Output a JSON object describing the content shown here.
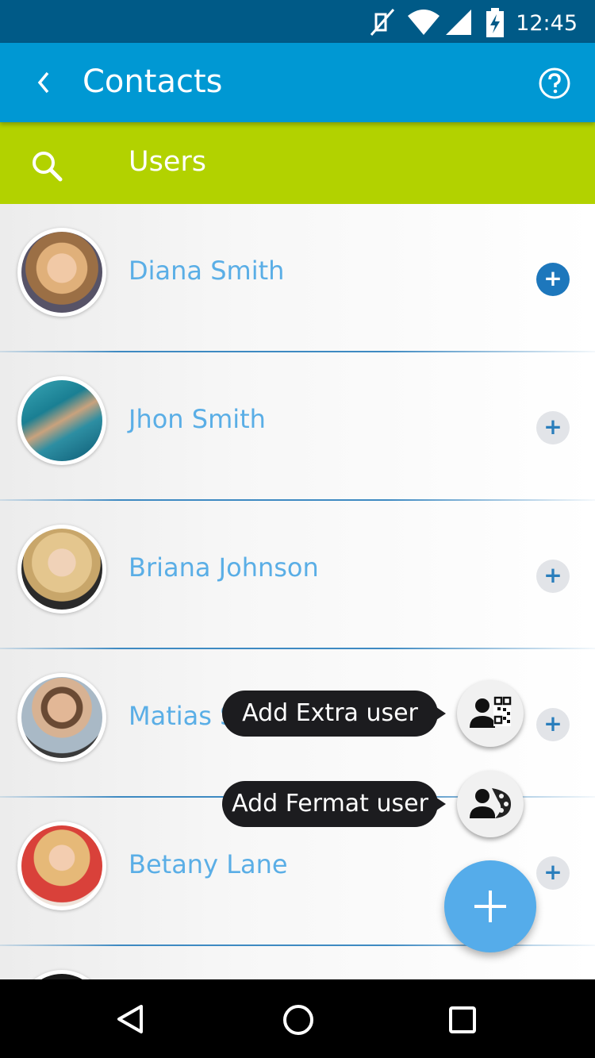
{
  "status_bar": {
    "time": "12:45",
    "icons": [
      "muted-icon",
      "wifi-icon",
      "signal-icon",
      "battery-charging-icon"
    ]
  },
  "app_bar": {
    "title": "Contacts",
    "back_icon": "chevron-left-icon",
    "help_icon": "help-circle-icon"
  },
  "tab_bar": {
    "label": "Users",
    "search_icon": "search-icon"
  },
  "contacts": [
    {
      "name": "Diana Smith",
      "action": "+",
      "active": true
    },
    {
      "name": "Jhon Smith",
      "action": "+"
    },
    {
      "name": "Briana Johnson",
      "action": "+"
    },
    {
      "name": "Matias S",
      "action": "+"
    },
    {
      "name": "Betany Lane",
      "action": "+"
    }
  ],
  "fab_menu": {
    "extra_label": "Add Extra user",
    "fermat_label": "Add Fermat user",
    "main_icon": "plus-icon"
  },
  "nav_bar": {
    "icons": [
      "back-triangle-icon",
      "home-circle-icon",
      "recents-square-icon"
    ]
  },
  "colors": {
    "status": "#005a87",
    "app_bar": "#0098d3",
    "tab_bar": "#b2d200",
    "name_text": "#5aaee6",
    "fab": "#55acea"
  }
}
